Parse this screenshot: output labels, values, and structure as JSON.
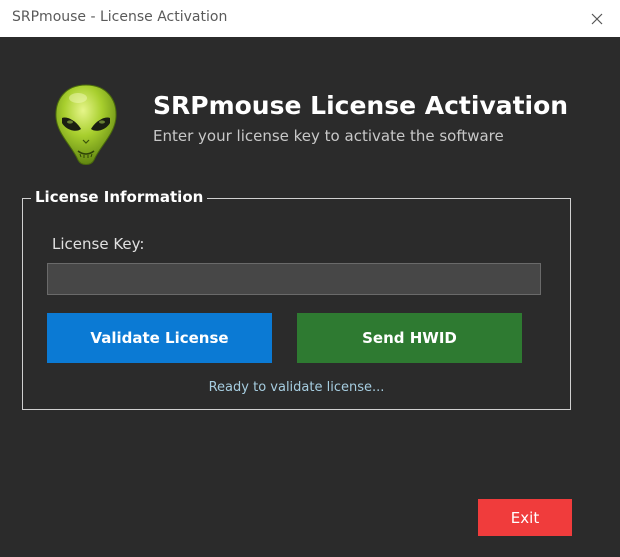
{
  "window": {
    "title": "SRPmouse - License Activation",
    "close_icon": "close-icon"
  },
  "header": {
    "logo_icon": "alien-head-icon",
    "title": "SRPmouse License Activation",
    "subtitle": "Enter your license key to activate the software"
  },
  "license": {
    "group_label": "License Information",
    "key_label": "License Key:",
    "key_value": "",
    "validate_label": "Validate License",
    "send_hwid_label": "Send HWID",
    "status": "Ready to validate license..."
  },
  "footer": {
    "exit_label": "Exit"
  },
  "colors": {
    "background": "#2b2b2b",
    "validate": "#0b7ad4",
    "hwid": "#2e7a31",
    "exit": "#f03c3c",
    "status_text": "#a6cde0"
  }
}
